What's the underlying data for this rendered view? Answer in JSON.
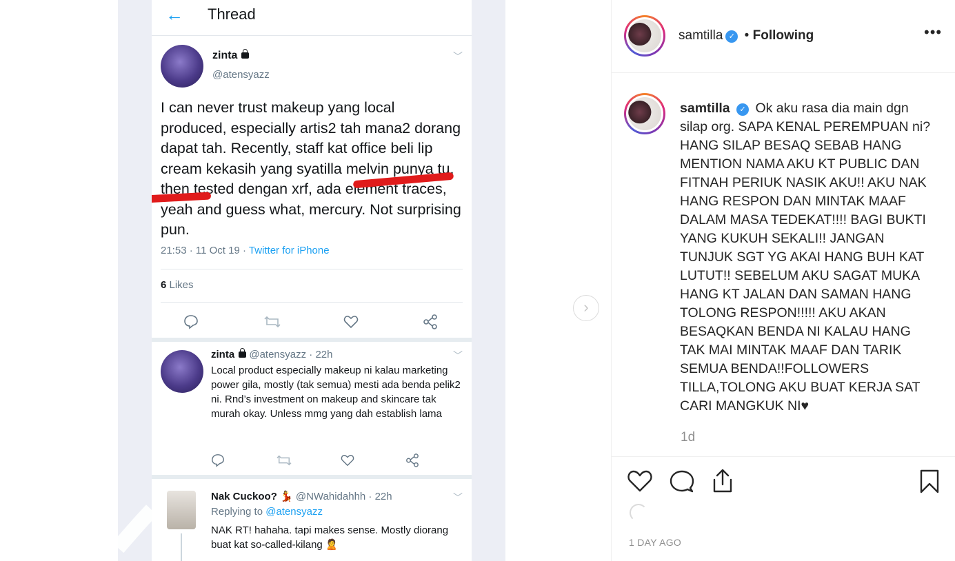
{
  "tweet": {
    "header_title": "Thread",
    "author_name": "zinta",
    "author_handle": "@atensyazz",
    "body": "I can never trust makeup yang local produced, especially artis2 tah mana2 dorang dapat tah. Recently, staff kat office beli lip cream kekasih yang syatilla melvin punya tu, then tested dengan xrf, ada element traces, yeah and guess what, mercury. Not surprising pun.",
    "meta_time": "21:53 · 11 Oct 19 · ",
    "meta_source": "Twitter for iPhone",
    "likes_count": "6",
    "likes_label": " Likes"
  },
  "reply1": {
    "name": "zinta",
    "handle_time": "@atensyazz · 22h",
    "body": "Local product especially makeup ni kalau marketing power gila, mostly (tak semua) mesti ada benda pelik2 ni. Rnd’s investment on makeup and skincare tak murah okay. Unless mmg yang dah establish lama"
  },
  "reply2": {
    "name": "Nak Cuckoo? 💃",
    "handle_time": "@NWahidahhh · 22h",
    "replying_prefix": "Replying to ",
    "replying_to": "@atensyazz",
    "body": "NAK RT! hahaha. tapi makes sense. Mostly diorang buat kat so-called-kilang 🙎"
  },
  "post": {
    "username": "samtilla",
    "follow_sep": " • ",
    "follow_status": "Following",
    "caption_user": "samtilla",
    "caption_text": "Ok aku rasa dia main dgn silap org. SAPA KENAL PEREMPUAN ni?HANG SILAP BESAQ SEBAB HANG MENTION NAMA AKU KT PUBLIC DAN FITNAH PERIUK NASIK AKU!! AKU NAK HANG RESPON DAN MINTAK MAAF DALAM MASA TEDEKAT!!!! BAGI BUKTI YANG KUKUH SEKALI!! JANGAN TUNJUK SGT YG AKAI HANG BUH KAT LUTUT!! SEBELUM AKU SAGAT MUKA HANG KT JALAN DAN SAMAN HANG TOLONG RESPON!!!!! AKU AKAN BESAQKAN BENDA NI KALAU HANG TAK MAI MINTAK MAAF DAN TARIK SEMUA BENDA!!FOLLOWERS TILLA,TOLONG AKU BUAT KERJA SAT CARI MANGKUK NI♥",
    "caption_age": "1d",
    "posted_ago": "1 DAY AGO",
    "more_label": "•••"
  },
  "colors": {
    "twitter_blue": "#1da1f2",
    "verified_blue": "#3897f0",
    "redline": "#e01b1b"
  }
}
